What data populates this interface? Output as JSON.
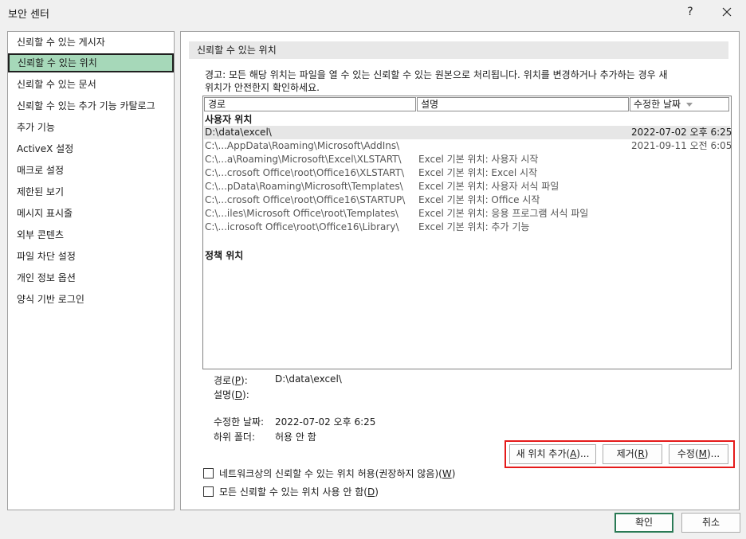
{
  "window": {
    "title": "보안 센터",
    "help_label": "?"
  },
  "sidebar": {
    "items": [
      {
        "label": "신뢰할 수 있는 게시자"
      },
      {
        "label": "신뢰할 수 있는 위치"
      },
      {
        "label": "신뢰할 수 있는 문서"
      },
      {
        "label": "신뢰할 수 있는 추가 기능 카탈로그"
      },
      {
        "label": "추가 기능"
      },
      {
        "label": "ActiveX 설정"
      },
      {
        "label": "매크로 설정"
      },
      {
        "label": "제한된 보기"
      },
      {
        "label": "메시지 표시줄"
      },
      {
        "label": "외부 콘텐츠"
      },
      {
        "label": "파일 차단 설정"
      },
      {
        "label": "개인 정보 옵션"
      },
      {
        "label": "양식 기반 로그인"
      }
    ],
    "active": "신뢰할 수 있는 위치"
  },
  "main": {
    "section_title": "신뢰할 수 있는 위치",
    "description_line1": "경고: 모든 해당 위치는 파일을 열 수 있는 신뢰할 수 있는 원본으로 처리됩니다. 위치를 변경하거나 추가하는 경우 새",
    "description_line2": "위치가 안전한지 확인하세요.",
    "table": {
      "columns": {
        "path": "경로",
        "description": "설명",
        "date": "수정한 날짜"
      },
      "user_group_label": "사용자 위치",
      "policy_group_label": "정책 위치",
      "rows": [
        {
          "path": "D:\\data\\excel\\",
          "description": "",
          "date": "2022-07-02 오후 6:25",
          "selected": true
        },
        {
          "path": "C:\\...AppData\\Roaming\\Microsoft\\AddIns\\",
          "description": "",
          "date": "2021-09-11 오전 6:05"
        },
        {
          "path": "C:\\...a\\Roaming\\Microsoft\\Excel\\XLSTART\\",
          "description": "Excel 기본 위치: 사용자 시작",
          "date": ""
        },
        {
          "path": "C:\\...crosoft Office\\root\\Office16\\XLSTART\\",
          "description": "Excel 기본 위치: Excel 시작",
          "date": ""
        },
        {
          "path": "C:\\...pData\\Roaming\\Microsoft\\Templates\\",
          "description": "Excel 기본 위치: 사용자 서식 파일",
          "date": ""
        },
        {
          "path": "C:\\...crosoft Office\\root\\Office16\\STARTUP\\",
          "description": "Excel 기본 위치: Office 시작",
          "date": ""
        },
        {
          "path": "C:\\...iles\\Microsoft Office\\root\\Templates\\",
          "description": "Excel 기본 위치: 응용 프로그램 서식 파일",
          "date": ""
        },
        {
          "path": "C:\\...icrosoft Office\\root\\Office16\\Library\\",
          "description": "Excel 기본 위치: 추가 기능",
          "date": ""
        }
      ]
    },
    "details": {
      "path_label": "경로",
      "path_key": "P",
      "path_value": "D:\\data\\excel\\",
      "desc_label": "설명",
      "desc_key": "D",
      "modified_label": "수정한 날짜:",
      "modified_value": "2022-07-02 오후 6:25",
      "subfolder_label": "하위 폴더:",
      "subfolder_value": "허용 안 함"
    },
    "buttons": {
      "add_text": "새 위치 추가(",
      "add_key": "A",
      "add_suffix": ")...",
      "remove_text": "제거(",
      "remove_key": "R",
      "remove_suffix": ")",
      "modify_text": "수정(",
      "modify_key": "M",
      "modify_suffix": ")..."
    },
    "checkboxes": {
      "network_text": "네트워크상의 신뢰할 수 있는 위치 허용(권장하지 않음)(",
      "network_key": "W",
      "network_suffix": ")",
      "network_checked": false,
      "disable_text": "모든 신뢰할 수 있는 위치 사용 안 함(",
      "disable_key": "D",
      "disable_suffix": ")",
      "disable_checked": false
    }
  },
  "footer": {
    "ok_label": "확인",
    "cancel_label": "취소"
  },
  "colors": {
    "active_nav": "#a6d8b9",
    "highlight_border": "#e51a1a",
    "ok_border": "#2a7a55"
  }
}
